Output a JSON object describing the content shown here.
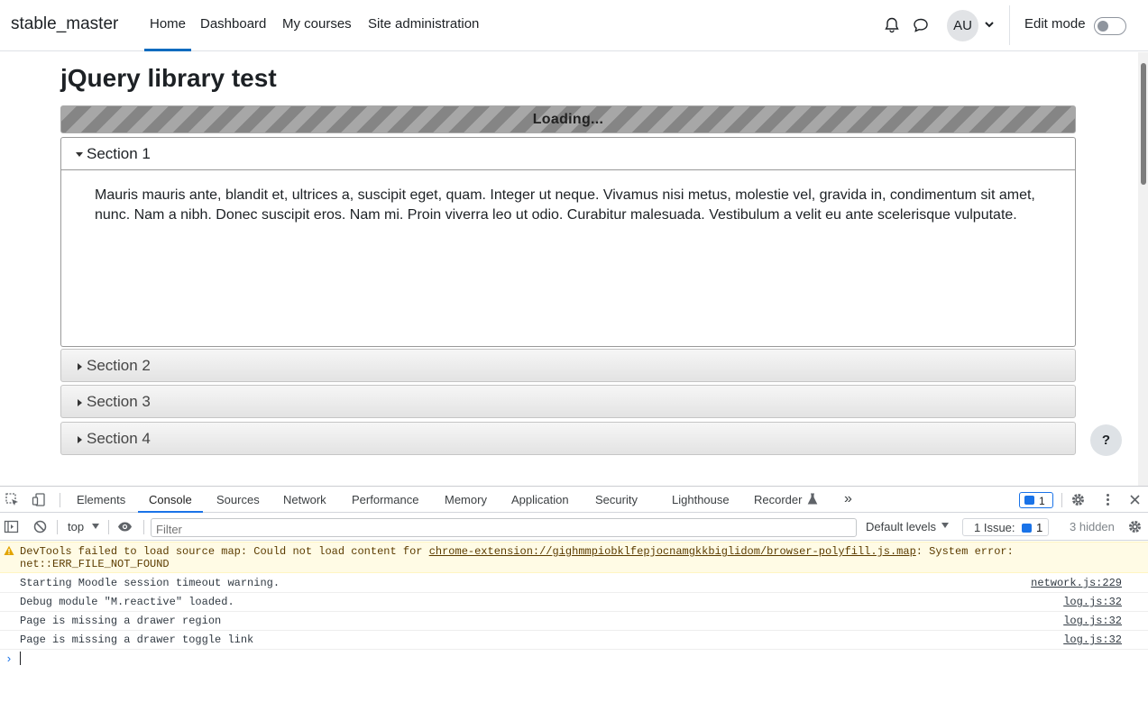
{
  "navbar": {
    "brand": "stable_master",
    "items": [
      {
        "label": "Home",
        "active": true
      },
      {
        "label": "Dashboard",
        "active": false
      },
      {
        "label": "My courses",
        "active": false
      },
      {
        "label": "Site administration",
        "active": false
      }
    ],
    "notifications_icon": "bell-icon",
    "messages_icon": "chat-bubble-icon",
    "avatar_initials": "AU",
    "edit_mode_label": "Edit mode",
    "edit_mode_on": false
  },
  "page": {
    "title": "jQuery library test",
    "progress_label": "Loading...",
    "sections": [
      {
        "label": "Section 1",
        "expanded": true
      },
      {
        "label": "Section 2",
        "expanded": false
      },
      {
        "label": "Section 3",
        "expanded": false
      },
      {
        "label": "Section 4",
        "expanded": false
      }
    ],
    "section1_text": "Mauris mauris ante, blandit et, ultrices a, suscipit eget, quam. Integer ut neque. Vivamus nisi metus, molestie vel, gravida in, condimentum sit amet, nunc. Nam a nibh. Donec suscipit eros. Nam mi. Proin viverra leo ut odio. Curabitur malesuada. Vestibulum a velit eu ante scelerisque vulputate.",
    "help_label": "?"
  },
  "devtools": {
    "tabs": [
      {
        "label": "Elements",
        "active": false
      },
      {
        "label": "Console",
        "active": true
      },
      {
        "label": "Sources",
        "active": false
      },
      {
        "label": "Network",
        "active": false
      },
      {
        "label": "Performance",
        "active": false
      },
      {
        "label": "Memory",
        "active": false
      },
      {
        "label": "Application",
        "active": false
      },
      {
        "label": "Security",
        "active": false
      },
      {
        "label": "Lighthouse",
        "active": false
      },
      {
        "label": "Recorder",
        "active": false
      }
    ],
    "more_tabs": "»",
    "message_badge_count": "1",
    "context": "top",
    "filter_placeholder": "Filter",
    "levels": "Default levels",
    "issues_label": "1 Issue:",
    "issues_count": "1",
    "hidden": "3 hidden",
    "warning": {
      "prefix": "DevTools failed to load source map: Could not load content for ",
      "link": "chrome-extension://gighmmpiobklfepjocnamgkkbiglidom/browser-polyfill.js.map",
      "suffix": ": System error: net::ERR_FILE_NOT_FOUND"
    },
    "logs": [
      {
        "text": "Starting Moodle session timeout warning.",
        "source": "network.js:229"
      },
      {
        "text": "Debug module \"M.reactive\" loaded.",
        "source": "log.js:32"
      },
      {
        "text": "Page is missing a drawer region",
        "source": "log.js:32"
      },
      {
        "text": "Page is missing a drawer toggle link",
        "source": "log.js:32"
      }
    ],
    "prompt": "›"
  }
}
